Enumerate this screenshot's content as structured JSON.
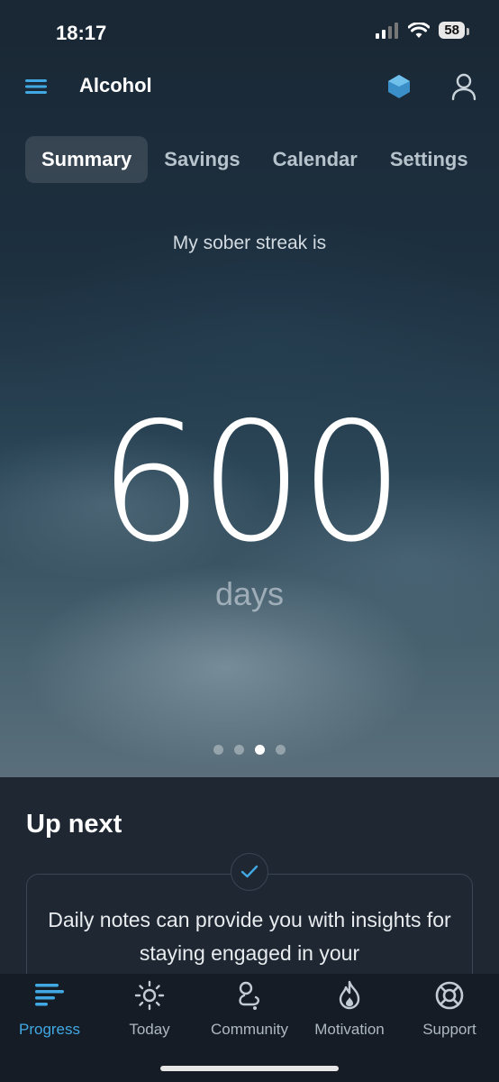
{
  "status_bar": {
    "time": "18:17",
    "battery": "58"
  },
  "header": {
    "title": "Alcohol"
  },
  "tabs": [
    {
      "label": "Summary",
      "active": true
    },
    {
      "label": "Savings",
      "active": false
    },
    {
      "label": "Calendar",
      "active": false
    },
    {
      "label": "Settings",
      "active": false
    }
  ],
  "streak": {
    "caption": "My sober streak is",
    "value": "600",
    "unit": "days"
  },
  "pager": {
    "count": 4,
    "active_index": 2
  },
  "up_next": {
    "title": "Up next",
    "card_text": "Daily notes can provide you with insights for staying engaged in your"
  },
  "bottom_nav": [
    {
      "label": "Progress",
      "icon": "progress-bars-icon",
      "active": true
    },
    {
      "label": "Today",
      "icon": "sun-icon",
      "active": false
    },
    {
      "label": "Community",
      "icon": "community-icon",
      "active": false
    },
    {
      "label": "Motivation",
      "icon": "flame-icon",
      "active": false
    },
    {
      "label": "Support",
      "icon": "lifebuoy-icon",
      "active": false
    }
  ],
  "colors": {
    "accent": "#41a8e3",
    "background": "#1f2732",
    "tabbar": "#151c25"
  }
}
